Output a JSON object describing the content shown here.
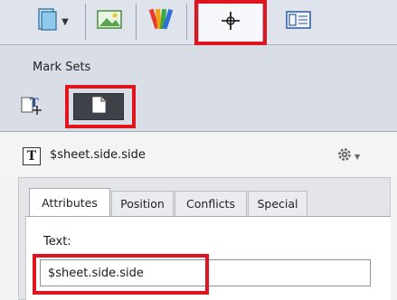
{
  "toolbar": {
    "items": [
      {
        "icon": "document-dropdown-icon",
        "active": false
      },
      {
        "icon": "image-edit-icon",
        "active": false
      },
      {
        "icon": "color-swatches-icon",
        "active": false
      },
      {
        "icon": "crosshair-icon",
        "active": true,
        "highlighted": true
      },
      {
        "icon": "panel-layout-icon",
        "active": false
      }
    ]
  },
  "mark_sets": {
    "title": "Mark Sets",
    "buttons": [
      {
        "icon": "text-mark-icon"
      },
      {
        "icon": "document-icon",
        "highlighted": true
      }
    ]
  },
  "mark": {
    "type_symbol": "T",
    "name": "$sheet.side.side",
    "menu_icon": "gear-icon"
  },
  "tabs": [
    {
      "label": "Attributes",
      "active": true
    },
    {
      "label": "Position",
      "active": false
    },
    {
      "label": "Conflicts",
      "active": false
    },
    {
      "label": "Special",
      "active": false
    }
  ],
  "attributes": {
    "text_label": "Text:",
    "text_value": "$sheet.side.side"
  },
  "colors": {
    "highlight": "#e0141e",
    "toolbar_bg": "#dfe3ec",
    "panel_bg": "#d9dde6"
  }
}
